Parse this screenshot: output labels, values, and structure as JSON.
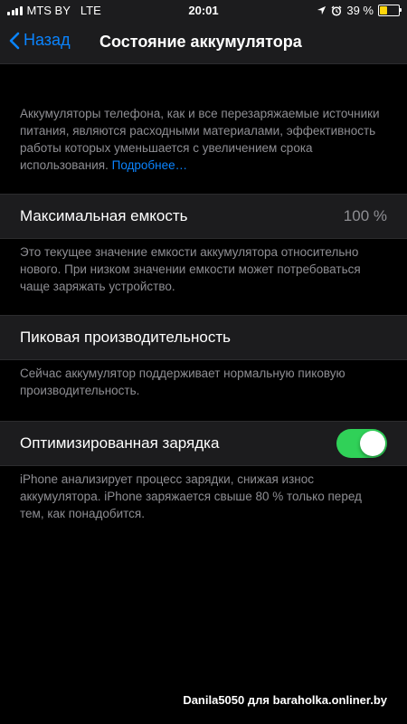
{
  "status_bar": {
    "carrier": "MTS BY",
    "network": "LTE",
    "time": "20:01",
    "battery_percent_text": "39 %",
    "battery_level": 0.39,
    "icons": [
      "signal-icon",
      "location-icon",
      "alarm-icon",
      "battery-icon"
    ]
  },
  "nav": {
    "back_label": "Назад",
    "title": "Состояние аккумулятора"
  },
  "intro": {
    "text": "Аккумуляторы телефона, как и все перезаряжаемые источники питания, являются расходными материалами, эффективность работы которых уменьшается с увеличением срока использования.",
    "link": "Подробнее…"
  },
  "max_capacity": {
    "label": "Максимальная емкость",
    "value": "100 %",
    "footer": "Это текущее значение емкости аккумулятора относительно нового. При низком значении емкости может потребоваться чаще заряжать устройство."
  },
  "peak_performance": {
    "label": "Пиковая производительность",
    "footer": "Сейчас аккумулятор поддерживает нормальную пиковую производительность."
  },
  "optimized_charging": {
    "label": "Оптимизированная зарядка",
    "enabled": true,
    "footer": "iPhone анализирует процесс зарядки, снижая износ аккумулятора. iPhone заряжается свыше 80 % только перед тем, как понадобится."
  },
  "watermark": "Danila5050 для baraholka.onliner.by",
  "colors": {
    "accent": "#0a84ff",
    "toggle_on": "#30d158",
    "battery_low": "#ffd60a",
    "background": "#000000",
    "cell": "#1c1c1e",
    "secondary_text": "#8e8e93"
  }
}
